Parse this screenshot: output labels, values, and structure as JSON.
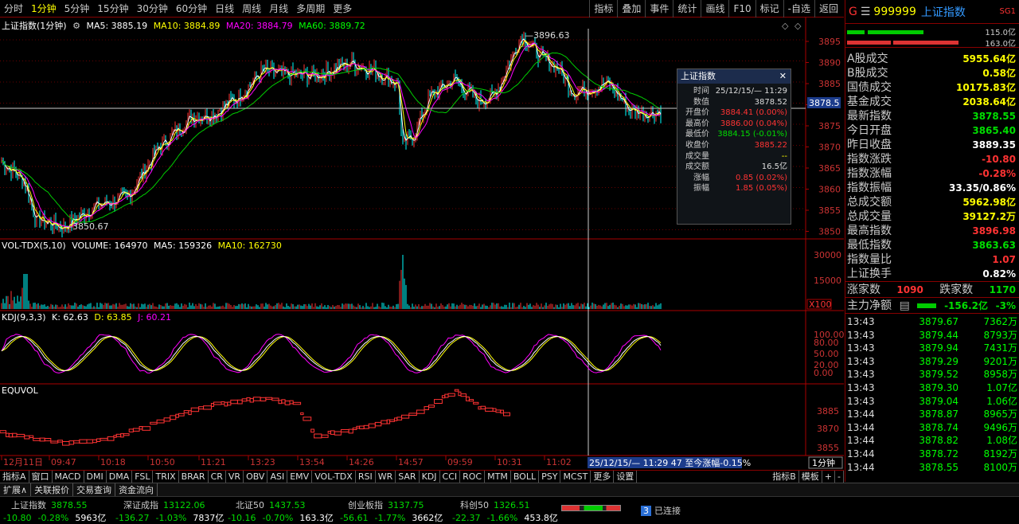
{
  "timeframes": [
    "分时",
    "1分钟",
    "5分钟",
    "15分钟",
    "30分钟",
    "60分钟",
    "日线",
    "周线",
    "月线",
    "多周期",
    "更多"
  ],
  "active_tf": "1分钟",
  "tools": [
    "指标",
    "叠加",
    "事件",
    "统计",
    "画线",
    "F10",
    "标记",
    "-自选",
    "返回"
  ],
  "main": {
    "title": "上证指数(1分钟)",
    "ma5": "MA5: 3885.19",
    "ma10": "MA10: 3884.89",
    "ma20": "MA20: 3884.79",
    "ma60": "MA60: 3889.72",
    "high_label": "3896.63",
    "low_label": "3850.67",
    "crosshair_price": "3878.5",
    "axis": [
      "3895",
      "3890",
      "3885",
      "3880",
      "3875",
      "3870",
      "3865",
      "3860",
      "3855",
      "3850"
    ]
  },
  "vol": {
    "title": "VOL-TDX(5,10)",
    "volume": "VOLUME: 164970",
    "ma5": "MA5: 159326",
    "ma10": "MA10: 162730",
    "axis": [
      "30000",
      "15000"
    ],
    "unit": "X100"
  },
  "kdj": {
    "title": "KDJ(9,3,3)",
    "k": "K: 62.63",
    "d": "D: 63.85",
    "j": "J: 60.21",
    "axis": [
      "100.00",
      "80.00",
      "50.00",
      "20.00",
      "0.00"
    ]
  },
  "equvol": {
    "title": "EQUVOL",
    "axis": [
      "3885",
      "3870",
      "3855"
    ]
  },
  "time_axis": [
    "12月11日",
    "09:47",
    "10:18",
    "10:50",
    "11:21",
    "13:23",
    "13:54",
    "14:26",
    "14:57",
    "09:59",
    "10:31",
    "11:02"
  ],
  "time_tip": "25/12/15/— 11:29 47 至今涨幅-0.15%",
  "period_btn": "1分钟",
  "infobox": {
    "title": "上证指数",
    "rows": [
      [
        "时间",
        "25/12/15/— 11:29"
      ],
      [
        "数值",
        "3878.52"
      ],
      [
        "开盘价",
        "3884.41 (0.00%)"
      ],
      [
        "最高价",
        "3886.00 (0.04%)"
      ],
      [
        "最低价",
        "3884.15 (-0.01%)"
      ],
      [
        "收盘价",
        "3885.22"
      ],
      [
        "成交量",
        "--"
      ],
      [
        "成交额",
        "16.5亿"
      ],
      [
        "涨幅",
        "0.85 (0.02%)"
      ],
      [
        "振幅",
        "1.85 (0.05%)"
      ]
    ]
  },
  "right": {
    "code": "999999",
    "name": "上证指数",
    "sg": "SG1",
    "bar1": "115.0亿",
    "bar2": "163.0亿",
    "stats": [
      [
        "A股成交",
        "5955.64亿"
      ],
      [
        "B股成交",
        "0.58亿"
      ],
      [
        "国债成交",
        "10175.83亿"
      ],
      [
        "基金成交",
        "2038.64亿"
      ],
      [
        "最新指数",
        "3878.55"
      ],
      [
        "今日开盘",
        "3865.40"
      ],
      [
        "昨日收盘",
        "3889.35"
      ],
      [
        "指数涨跌",
        "-10.80"
      ],
      [
        "指数涨幅",
        "-0.28%"
      ],
      [
        "指数振幅",
        "33.35/0.86%"
      ],
      [
        "总成交额",
        "5962.98亿"
      ],
      [
        "总成交量",
        "39127.2万"
      ],
      [
        "最高指数",
        "3896.98"
      ],
      [
        "最低指数",
        "3863.63"
      ],
      [
        "指数量比",
        "1.07"
      ],
      [
        "上证换手",
        "0.82%"
      ]
    ],
    "rise_label": "涨家数",
    "rise": "1090",
    "fall_label": "跌家数",
    "fall": "1170",
    "flow_label": "主力净额",
    "flow": "-156.2亿",
    "flow_pct": "-3%",
    "ticks": [
      [
        "13:43",
        "3879.67",
        "7362万"
      ],
      [
        "13:43",
        "3879.44",
        "8793万"
      ],
      [
        "13:43",
        "3879.94",
        "7431万"
      ],
      [
        "13:43",
        "3879.29",
        "9201万"
      ],
      [
        "13:43",
        "3879.52",
        "8958万"
      ],
      [
        "13:43",
        "3879.30",
        "1.07亿"
      ],
      [
        "13:43",
        "3879.04",
        "1.06亿"
      ],
      [
        "13:44",
        "3878.87",
        "8965万"
      ],
      [
        "13:44",
        "3878.74",
        "9496万"
      ],
      [
        "13:44",
        "3878.82",
        "1.08亿"
      ],
      [
        "13:44",
        "3878.72",
        "8192万"
      ],
      [
        "13:44",
        "3878.55",
        "8100万"
      ]
    ]
  },
  "tabs": [
    "指标A",
    "窗口",
    "MACD",
    "DMI",
    "DMA",
    "FSL",
    "TRIX",
    "BRAR",
    "CR",
    "VR",
    "OBV",
    "ASI",
    "EMV",
    "VOL-TDX",
    "RSI",
    "WR",
    "SAR",
    "KDJ",
    "CCI",
    "ROC",
    "MTM",
    "BOLL",
    "PSY",
    "MCST",
    "更多",
    "设置"
  ],
  "tabs_right": [
    "指标B",
    "模板",
    "+",
    "-"
  ],
  "tabs2": [
    "扩展∧",
    "关联报价",
    "交易查询",
    "资金流向"
  ],
  "status": [
    {
      "name": "上证指数",
      "val": "3878.55",
      "chg": "-10.80",
      "pct": "-0.28%",
      "amt": "5963亿"
    },
    {
      "name": "深证成指",
      "val": "13122.06",
      "chg": "-136.27",
      "pct": "-1.03%",
      "amt": "7837亿"
    },
    {
      "name": "北证50",
      "val": "1437.53",
      "chg": "-10.16",
      "pct": "-0.70%",
      "amt": "163.3亿"
    },
    {
      "name": "创业板指",
      "val": "3137.75",
      "chg": "-56.61",
      "pct": "-1.77%",
      "amt": "3662亿"
    },
    {
      "name": "科创50",
      "val": "1326.51",
      "chg": "-22.37",
      "pct": "-1.66%",
      "amt": "453.8亿"
    }
  ],
  "conn": "已连接",
  "conn_num": "3"
}
